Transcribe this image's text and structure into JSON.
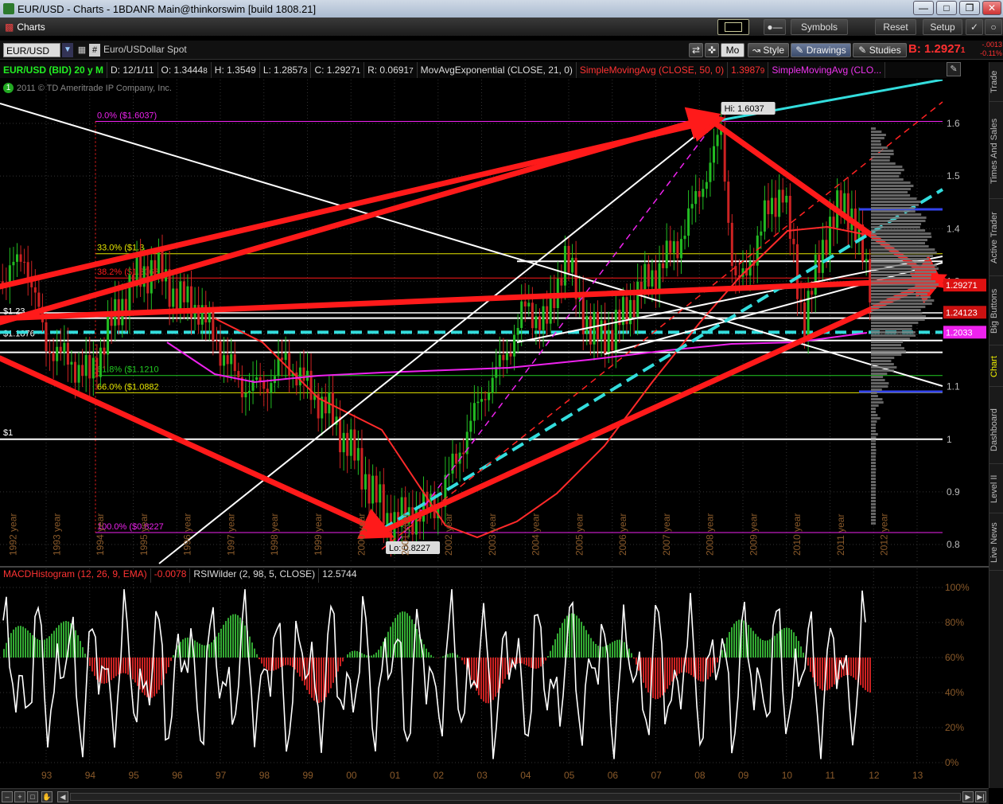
{
  "window": {
    "title": "EUR/USD - Charts - 1BDANR Main@thinkorswim [build 1808.21]"
  },
  "toolbar": {
    "tab": "Charts",
    "symbols": "Symbols",
    "reset": "Reset",
    "setup": "Setup"
  },
  "symbol_bar": {
    "symbol": "EUR/USD",
    "description": "Euro/USDollar Spot",
    "period": "Mo",
    "style": "Style",
    "drawings": "Drawings",
    "studies": "Studies",
    "bid": "B: 1.2927",
    "bid_suffix": "1",
    "change1": "-.0013",
    "change2": "-0.11%"
  },
  "info": {
    "name": "EUR/USD (BID) 20 y M",
    "date": "D: 12/1/11",
    "open": "O: 1.3444",
    "open_s": "8",
    "high": "H: 1.3549",
    "low": "L: 1.2857",
    "low_s": "3",
    "close": "C: 1.2927",
    "close_s": "1",
    "range": "R: 0.0691",
    "range_s": "7",
    "ema": "MovAvgExponential (CLOSE, 21, 0)",
    "sma50": "SimpleMovingAvg (CLOSE, 50, 0)",
    "sma50_val": "1.3987",
    "sma50_val_s": "9",
    "sma2": "SimpleMovingAvg (CLO..."
  },
  "copyright": "2011 © TD Ameritrade IP Company, Inc.",
  "colors": {
    "red": "#ff1a1a",
    "white": "#ffffff",
    "cyan": "#33dddd",
    "magenta": "#ee22ee",
    "yellow": "#e6e600",
    "green": "#22cc22",
    "candle_up": "#22bb22",
    "candle_down": "#cc2222"
  },
  "fib": [
    {
      "label": "0.0%",
      "value_label": "($1.6037)",
      "price": 1.6037,
      "color": "magenta"
    },
    {
      "label": "33.0%",
      "value_label": "($1.3",
      "price": 1.3524,
      "color": "yellow"
    },
    {
      "label": "38.2%",
      "value_label": "($1.3063",
      "price": 1.3063,
      "color": "red"
    },
    {
      "label": "61.8%",
      "value_label": "($1.1210",
      "price": 1.121,
      "color": "green"
    },
    {
      "label": "66.0%",
      "value_label": "($1.0882",
      "price": 1.0882,
      "color": "yellow"
    },
    {
      "label": "100.0%",
      "value_label": "($0.8227",
      "price": 0.8227,
      "color": "magenta"
    }
  ],
  "hlines": [
    {
      "label": "$1.23",
      "price": 1.23
    },
    {
      "label": "$1.1876",
      "price": 1.1876
    },
    {
      "label": "$1",
      "price": 1.0
    }
  ],
  "hi_label": "Hi: 1.6037",
  "lo_label": "Lo: 0.8227",
  "price_markers": [
    {
      "text": "1.2927",
      "suffix": "1",
      "price": 1.2927,
      "bg": "#dd1111",
      "fg": "#fff"
    },
    {
      "text": "1.2412",
      "suffix": "3",
      "price": 1.2412,
      "bg": "#cc1111",
      "fg": "#fff"
    },
    {
      "text": "1.2033",
      "suffix": "",
      "price": 1.2033,
      "bg": "#ee22ee",
      "fg": "#fff"
    }
  ],
  "year_labels": [
    "1992 year",
    "1993 year",
    "1994 year",
    "1995 year",
    "1996 year",
    "1997 year",
    "1998 year",
    "1999 year",
    "2000 year",
    "2001 year",
    "2002 year",
    "2003 year",
    "2004 year",
    "2005 year",
    "2006 year",
    "2007 year",
    "2008 year",
    "2009 year",
    "2010 year",
    "2011 year",
    "2012 year"
  ],
  "lower": {
    "macd": "MACDHistogram (12, 26, 9, EMA)",
    "macd_val": "-0.0078",
    "rsi": "RSIWilder (2, 98, 5, CLOSE)",
    "rsi_val": "12.5744"
  },
  "chart_data": {
    "type": "candlestick",
    "symbol": "EUR/USD",
    "interval": "monthly",
    "x_ticks": [
      "93",
      "94",
      "95",
      "96",
      "97",
      "98",
      "99",
      "00",
      "01",
      "02",
      "03",
      "04",
      "05",
      "06",
      "07",
      "08",
      "09",
      "10",
      "11",
      "12",
      "13"
    ],
    "y_ticks": [
      "1.6",
      "1.5",
      "1.4",
      "1.3",
      "1.2",
      "1.1",
      "1",
      "0.9",
      "0.8"
    ],
    "ylim": [
      0.78,
      1.68
    ],
    "lower_y_ticks": [
      "100%",
      "80%",
      "60%",
      "40%",
      "20%",
      "0%"
    ],
    "series_close_approx": [
      [
        1992.0,
        1.3
      ],
      [
        1992.5,
        1.35
      ],
      [
        1993.0,
        1.18
      ],
      [
        1993.5,
        1.15
      ],
      [
        1994.0,
        1.12
      ],
      [
        1994.5,
        1.22
      ],
      [
        1995.0,
        1.3
      ],
      [
        1995.5,
        1.33
      ],
      [
        1996.0,
        1.27
      ],
      [
        1996.5,
        1.25
      ],
      [
        1997.0,
        1.17
      ],
      [
        1997.5,
        1.1
      ],
      [
        1998.0,
        1.1
      ],
      [
        1998.5,
        1.15
      ],
      [
        1999.0,
        1.1
      ],
      [
        1999.5,
        1.05
      ],
      [
        2000.0,
        0.98
      ],
      [
        2000.5,
        0.9
      ],
      [
        2000.9,
        0.84
      ],
      [
        2001.5,
        0.86
      ],
      [
        2002.0,
        0.88
      ],
      [
        2002.5,
        0.98
      ],
      [
        2003.0,
        1.08
      ],
      [
        2003.5,
        1.15
      ],
      [
        2004.0,
        1.25
      ],
      [
        2004.5,
        1.22
      ],
      [
        2004.9,
        1.35
      ],
      [
        2005.5,
        1.2
      ],
      [
        2006.0,
        1.2
      ],
      [
        2006.5,
        1.27
      ],
      [
        2007.0,
        1.32
      ],
      [
        2007.5,
        1.37
      ],
      [
        2008.0,
        1.47
      ],
      [
        2008.5,
        1.58
      ],
      [
        2008.8,
        1.3
      ],
      [
        2009.0,
        1.3
      ],
      [
        2009.5,
        1.42
      ],
      [
        2009.9,
        1.48
      ],
      [
        2010.4,
        1.22
      ],
      [
        2010.9,
        1.39
      ],
      [
        2011.3,
        1.45
      ],
      [
        2011.5,
        1.43
      ],
      [
        2011.9,
        1.29
      ]
    ]
  }
}
